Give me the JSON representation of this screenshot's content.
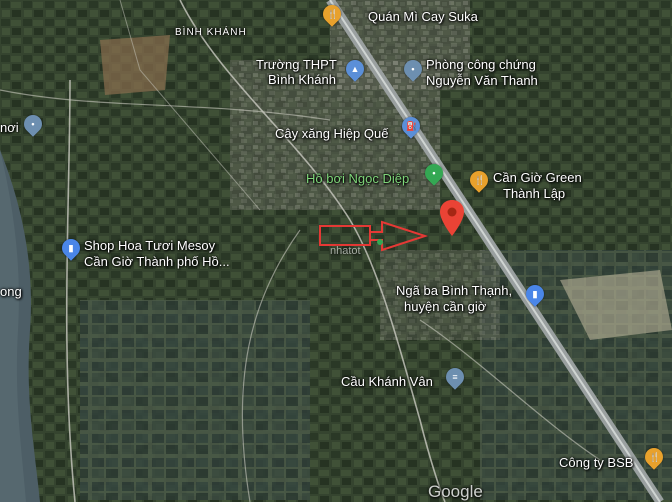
{
  "map": {
    "labels": {
      "binh_khanh": "BÌNH KHÁNH",
      "quan_mi": "Quán Mì Cay Suka",
      "truong_line1": "Trường THPT",
      "truong_line2": "Bình Khánh",
      "phong_line1": "Phòng công chứng",
      "phong_line2": "Nguyễn Văn Thanh",
      "cay_xang": "Cây xăng Hiệp Quế",
      "ho_boi": "Hồ bơi Ngọc Diệp",
      "can_gio_line1": "Cần Giờ Green",
      "can_gio_line2": "Thành Lập",
      "shop_line1": "Shop Hoa Tươi Mesoy",
      "shop_line2": "Cần Giờ Thành phố Hồ...",
      "noi": "nơi",
      "ong": "ong",
      "nga_ba_line1": "Ngã ba Bình Thạnh,",
      "nga_ba_line2": "huyện cần giờ",
      "cau": "Cầu Khánh Vân",
      "cong_ty": "Công ty BSB",
      "google": "Google",
      "watermark": "nhatot"
    },
    "icons": {
      "restaurant": "fork-knife-icon",
      "school": "graduation-cap-icon",
      "place": "place-pin-icon",
      "gas": "fuel-pump-icon",
      "park": "tree-pin-icon",
      "shopping": "shopping-bag-icon",
      "bridge": "bridge-icon",
      "selected": "red-location-pin-icon"
    },
    "colors": {
      "restaurant": "#e8a12c",
      "school": "#5b8fd8",
      "place": "#6d8fb0",
      "park": "#34a853",
      "shopping": "#4a86e8",
      "selected": "#ea4335",
      "annotation": "#e53935"
    }
  }
}
